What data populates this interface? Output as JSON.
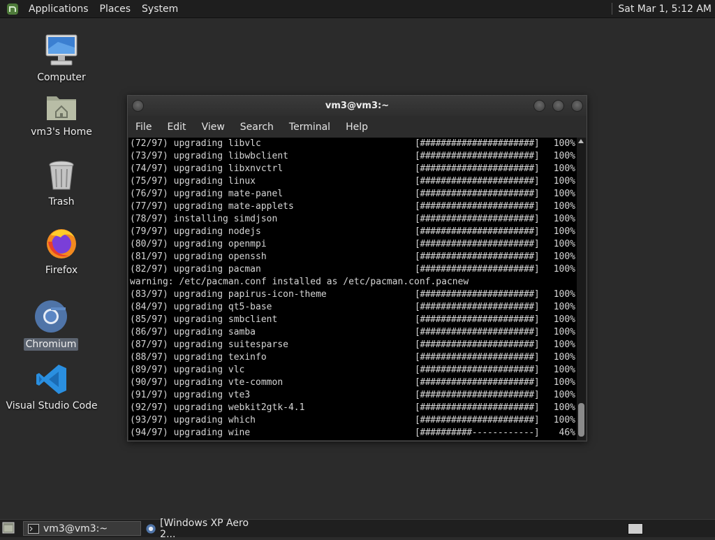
{
  "top_panel": {
    "menus": [
      "Applications",
      "Places",
      "System"
    ],
    "clock": "Sat Mar  1,  5:12 AM"
  },
  "desktop_icons": [
    {
      "label": "Computer",
      "icon": "computer-icon"
    },
    {
      "label": "vm3's Home",
      "icon": "home-folder-icon"
    },
    {
      "label": "Trash",
      "icon": "trash-icon"
    },
    {
      "label": "Firefox",
      "icon": "firefox-icon"
    },
    {
      "label": "Chromium",
      "icon": "chromium-icon",
      "selected": true
    },
    {
      "label": "Visual Studio Code",
      "icon": "vscode-icon"
    }
  ],
  "terminal": {
    "title": "vm3@vm3:~",
    "menus": [
      "File",
      "Edit",
      "View",
      "Search",
      "Terminal",
      "Help"
    ],
    "lines": [
      {
        "msg": "(72/97) upgrading libvlc",
        "bar": "[######################]",
        "pct": "100%"
      },
      {
        "msg": "(73/97) upgrading libwbclient",
        "bar": "[######################]",
        "pct": "100%"
      },
      {
        "msg": "(74/97) upgrading libxnvctrl",
        "bar": "[######################]",
        "pct": "100%"
      },
      {
        "msg": "(75/97) upgrading linux",
        "bar": "[######################]",
        "pct": "100%"
      },
      {
        "msg": "(76/97) upgrading mate-panel",
        "bar": "[######################]",
        "pct": "100%"
      },
      {
        "msg": "(77/97) upgrading mate-applets",
        "bar": "[######################]",
        "pct": "100%"
      },
      {
        "msg": "(78/97) installing simdjson",
        "bar": "[######################]",
        "pct": "100%"
      },
      {
        "msg": "(79/97) upgrading nodejs",
        "bar": "[######################]",
        "pct": "100%"
      },
      {
        "msg": "(80/97) upgrading openmpi",
        "bar": "[######################]",
        "pct": "100%"
      },
      {
        "msg": "(81/97) upgrading openssh",
        "bar": "[######################]",
        "pct": "100%"
      },
      {
        "msg": "(82/97) upgrading pacman",
        "bar": "[######################]",
        "pct": "100%"
      },
      {
        "msg": "warning: /etc/pacman.conf installed as /etc/pacman.conf.pacnew",
        "bar": "",
        "pct": ""
      },
      {
        "msg": "(83/97) upgrading papirus-icon-theme",
        "bar": "[######################]",
        "pct": "100%"
      },
      {
        "msg": "(84/97) upgrading qt5-base",
        "bar": "[######################]",
        "pct": "100%"
      },
      {
        "msg": "(85/97) upgrading smbclient",
        "bar": "[######################]",
        "pct": "100%"
      },
      {
        "msg": "(86/97) upgrading samba",
        "bar": "[######################]",
        "pct": "100%"
      },
      {
        "msg": "(87/97) upgrading suitesparse",
        "bar": "[######################]",
        "pct": "100%"
      },
      {
        "msg": "(88/97) upgrading texinfo",
        "bar": "[######################]",
        "pct": "100%"
      },
      {
        "msg": "(89/97) upgrading vlc",
        "bar": "[######################]",
        "pct": "100%"
      },
      {
        "msg": "(90/97) upgrading vte-common",
        "bar": "[######################]",
        "pct": "100%"
      },
      {
        "msg": "(91/97) upgrading vte3",
        "bar": "[######################]",
        "pct": "100%"
      },
      {
        "msg": "(92/97) upgrading webkit2gtk-4.1",
        "bar": "[######################]",
        "pct": "100%"
      },
      {
        "msg": "(93/97) upgrading which",
        "bar": "[######################]",
        "pct": "100%"
      },
      {
        "msg": "(94/97) upgrading wine",
        "bar": "[##########------------]",
        "pct": "46%"
      }
    ]
  },
  "taskbar": {
    "items": [
      {
        "label": "vm3@vm3:~",
        "icon": "terminal-icon",
        "active": true
      },
      {
        "label": "[Windows XP Aero 2...",
        "icon": "chromium-icon",
        "active": false
      }
    ]
  },
  "colors": {
    "desktop_bg": "#2b2b2b",
    "panel_bg": "#1e1e1e",
    "terminal_bg": "#000000",
    "selection_bg": "#5c6470"
  }
}
